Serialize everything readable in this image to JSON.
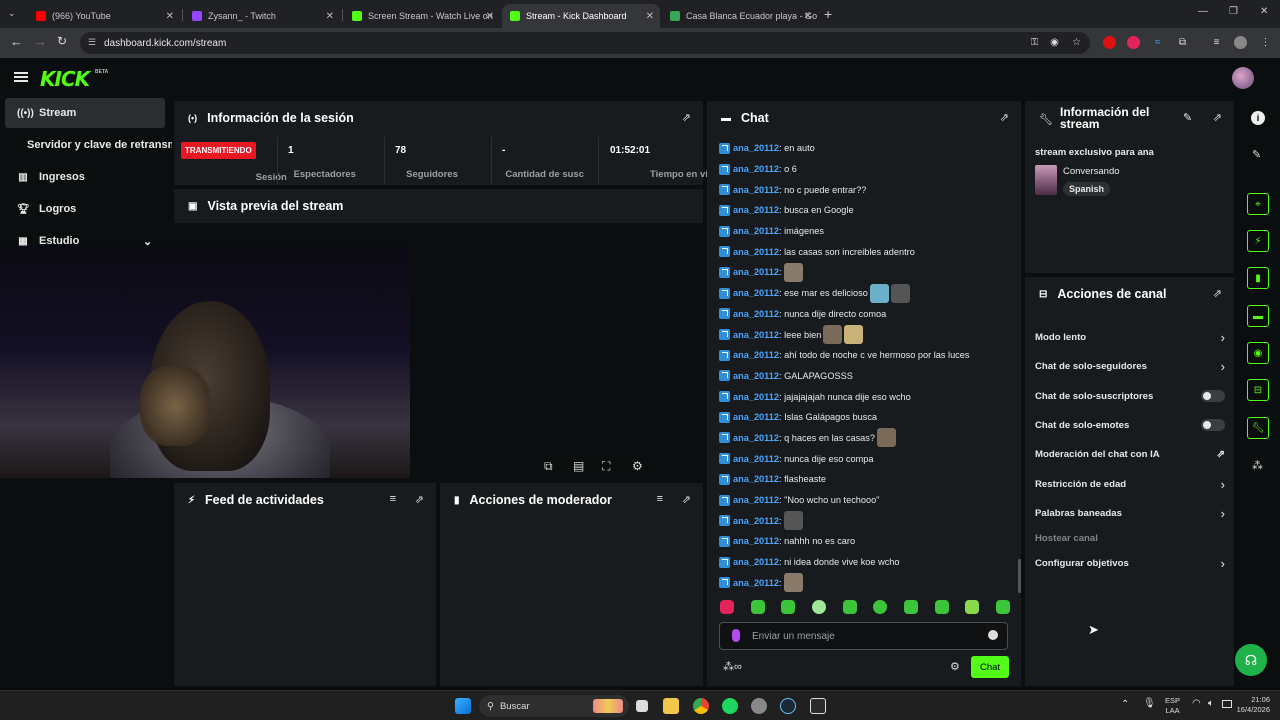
{
  "browser": {
    "tabs": [
      {
        "title": "(966) YouTube",
        "color": "#ff0000",
        "active": false
      },
      {
        "title": "Zysann_ - Twitch",
        "color": "#9146ff",
        "active": false
      },
      {
        "title": "Screen Stream - Watch Live on",
        "color": "#53fc18",
        "active": false
      },
      {
        "title": "Stream - Kick Dashboard",
        "color": "#53fc18",
        "active": true
      },
      {
        "title": "Casa Blanca Ecuador playa - Go",
        "color": "#34a853",
        "active": false
      }
    ],
    "url": "dashboard.kick.com/stream"
  },
  "header": {
    "logo": "KICK",
    "beta": "BETA"
  },
  "sidebar": {
    "items": [
      {
        "label": "Stream",
        "icon": "broadcast-icon"
      },
      {
        "label": "Servidor y clave de retransmisión",
        "icon": ""
      },
      {
        "label": "Ingresos",
        "icon": "chart-icon"
      },
      {
        "label": "Logros",
        "icon": "trophy-icon"
      },
      {
        "label": "Estudio",
        "icon": "studio-icon"
      }
    ]
  },
  "session": {
    "title": "Información de la sesión",
    "status_badge": "TRANSMITIENDO",
    "status_label": "Sesión",
    "stats": [
      {
        "value": "1",
        "label": "Espectadores"
      },
      {
        "value": "78",
        "label": "Seguidores"
      },
      {
        "value": "-",
        "label": "Cantidad de suscripciones"
      },
      {
        "value": "01:52:01",
        "label": "Tiempo en vivo"
      }
    ]
  },
  "preview": {
    "title": "Vista previa del stream"
  },
  "feed": {
    "title": "Feed de actividades"
  },
  "modactions": {
    "title": "Acciones de moderador"
  },
  "chat": {
    "title": "Chat",
    "messages": [
      {
        "user": "ana_20112",
        "text": ": en auto",
        "emotes": 0
      },
      {
        "user": "ana_20112",
        "text": ": o 6",
        "emotes": 0
      },
      {
        "user": "ana_20112",
        "text": ": no c puede entrar??",
        "emotes": 0
      },
      {
        "user": "ana_20112",
        "text": ": busca en Google",
        "emotes": 0
      },
      {
        "user": "ana_20112",
        "text": ": imágenes",
        "emotes": 0
      },
      {
        "user": "ana_20112",
        "text": ": las casas son increibles adentro",
        "emotes": 0
      },
      {
        "user": "ana_20112",
        "text": ":",
        "emotes": 1
      },
      {
        "user": "ana_20112",
        "text": ": ese mar es delicioso",
        "emotes": 2
      },
      {
        "user": "ana_20112",
        "text": ": nunca dije directo comoa",
        "emotes": 0
      },
      {
        "user": "ana_20112",
        "text": ": leee bien",
        "emotes": 2
      },
      {
        "user": "ana_20112",
        "text": ": ahí todo de noche c ve hermoso por las luces",
        "emotes": 0
      },
      {
        "user": "ana_20112",
        "text": ": GALAPAGOSSS",
        "emotes": 0
      },
      {
        "user": "ana_20112",
        "text": ": jajajajajah nunca dije eso wcho",
        "emotes": 0
      },
      {
        "user": "ana_20112",
        "text": ": Islas Galápagos busca",
        "emotes": 0
      },
      {
        "user": "ana_20112",
        "text": ": q haces en las casas?",
        "emotes": 1
      },
      {
        "user": "ana_20112",
        "text": ": nunca dije eso compa",
        "emotes": 0
      },
      {
        "user": "ana_20112",
        "text": ": flasheaste",
        "emotes": 0
      },
      {
        "user": "ana_20112",
        "text": ": \"Noo wcho un techooo\"",
        "emotes": 0
      },
      {
        "user": "ana_20112",
        "text": ":",
        "emotes": 1
      },
      {
        "user": "ana_20112",
        "text": ": nahhh no es caro",
        "emotes": 0
      },
      {
        "user": "ana_20112",
        "text": ": ni idea donde vive koe wcho",
        "emotes": 0
      },
      {
        "user": "ana_20112",
        "text": ":",
        "emotes": 1
      }
    ],
    "input_placeholder": "Enviar un mensaje",
    "send_label": "Chat"
  },
  "streaminfo": {
    "title": "Información del stream",
    "stream_title": "stream exclusivo para ana",
    "category": "Conversando",
    "language": "Spanish"
  },
  "channelactions": {
    "title": "Acciones de canal",
    "items": [
      {
        "label": "Modo lento",
        "control": "chevron"
      },
      {
        "label": "Chat de solo-seguidores",
        "control": "chevron"
      },
      {
        "label": "Chat de solo-suscriptores",
        "control": "toggle"
      },
      {
        "label": "Chat de solo-emotes",
        "control": "toggle"
      },
      {
        "label": "Moderación del chat con IA",
        "control": "external"
      },
      {
        "label": "Restricción de edad",
        "control": "chevron"
      },
      {
        "label": "Palabras baneadas",
        "control": "chevron"
      },
      {
        "label": "Hostear canal",
        "control": "none",
        "disabled": true
      },
      {
        "label": "Configurar objetivos",
        "control": "chevron"
      }
    ]
  },
  "taskbar": {
    "search_label": "Buscar",
    "lang1": "ESP",
    "lang2": "LAA",
    "time": "21:06",
    "date": "16/4/2026"
  },
  "colors": {
    "accent": "#53fc18",
    "live": "#e71823",
    "username": "#4ba3ff"
  }
}
